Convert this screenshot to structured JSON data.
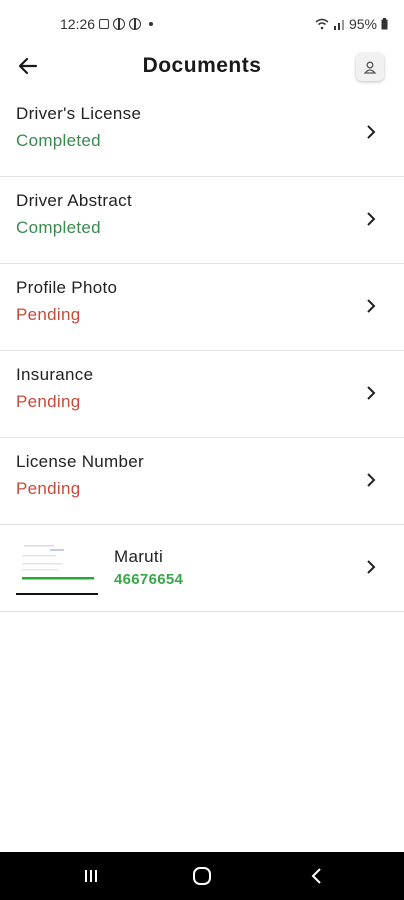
{
  "status_bar": {
    "time": "12:26",
    "battery": "95%"
  },
  "header": {
    "title": "Documents"
  },
  "documents": [
    {
      "label": "Driver's License",
      "status": "Completed",
      "status_color": "#3a8a4f"
    },
    {
      "label": "Driver Abstract",
      "status": "Completed",
      "status_color": "#3a8a4f"
    },
    {
      "label": "Profile Photo",
      "status": "Pending",
      "status_color": "#c84a3a"
    },
    {
      "label": "Insurance",
      "status": "Pending",
      "status_color": "#c84a3a"
    },
    {
      "label": "License Number",
      "status": "Pending",
      "status_color": "#c84a3a"
    }
  ],
  "vehicle": {
    "name": "Maruti",
    "number": "46676654",
    "number_color": "#3aa64a"
  },
  "icons": {
    "back": "arrow-left-icon",
    "profile": "person-icon",
    "chevron": "chevron-right-icon",
    "nav_recents": "recents-icon",
    "nav_home": "home-icon",
    "nav_back": "back-icon"
  }
}
